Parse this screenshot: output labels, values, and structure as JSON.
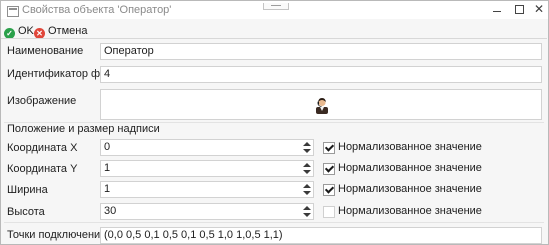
{
  "window": {
    "title": "Свойства объекта 'Оператор'",
    "icon": "window-icon"
  },
  "titlebar_buttons": {
    "minimize": "minimize-icon",
    "maximize": "maximize-icon",
    "close": "✕"
  },
  "toolbar": {
    "ok_label": "OK",
    "cancel_label": "Отмена",
    "ok_icon": "check-circle-icon",
    "cancel_icon": "cross-circle-icon"
  },
  "form": {
    "name_label": "Наименование",
    "name_value": "Оператор",
    "form_id_label": "Идентификатор формы",
    "form_id_value": "4",
    "image_label": "Изображение",
    "image_icon": "operator-person-icon",
    "section_title": "Положение и размер надписи",
    "coord_x_label": "Координата X",
    "coord_x_value": "0",
    "coord_x_normalized": "Нормализованное значение",
    "coord_y_label": "Координата Y",
    "coord_y_value": "1",
    "coord_y_normalized": "Нормализованное значение",
    "width_label": "Ширина",
    "width_value": "1",
    "width_normalized": "Нормализованное значение",
    "height_label": "Высота",
    "height_value": "30",
    "height_normalized": "Нормализованное значение",
    "connection_points_label": "Точки подключения",
    "connection_points_value": "(0,0 0,5 0,1 0,5 0,1 0,5 1,0 1,0,5 1,1)"
  },
  "checkbox_states": {
    "coord_x": true,
    "coord_y": true,
    "width": true,
    "height": false
  },
  "colors": {
    "ok_green": "#2aa04a",
    "cancel_red": "#e0463a",
    "window_bg": "#f6f6f6"
  }
}
